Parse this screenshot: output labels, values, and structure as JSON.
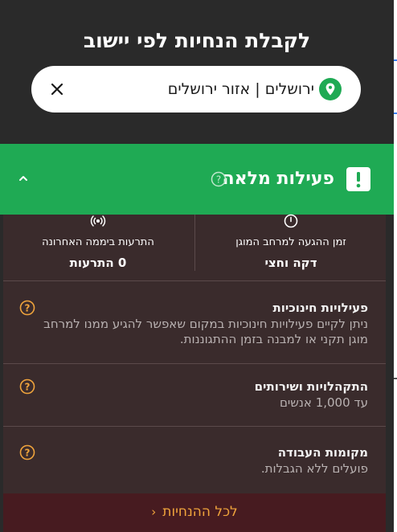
{
  "header": {
    "title": "לקבלת הנחיות לפי יישוב"
  },
  "search": {
    "value": "ירושלים | אזור ירושלים",
    "pin_icon": "location-pin-icon",
    "clear_icon": "close-icon"
  },
  "status": {
    "label": "פעילות מלאה",
    "color": "#1faa54",
    "alert_icon": "exclamation-icon",
    "help_icon": "question-circle-icon",
    "toggle_icon": "chevron-up-icon"
  },
  "stats": {
    "arrival": {
      "caption": "זמן ההגעה למרחב המוגן",
      "value": "דקה וחצי",
      "icon": "clock-icon"
    },
    "alerts": {
      "caption": "התרעות ביממה האחרונה",
      "value": "0 התרעות",
      "icon": "broadcast-icon"
    }
  },
  "items": [
    {
      "title": "פעילויות חינוכיות",
      "description": "ניתן לקיים פעילויות חינוכיות במקום שאפשר להגיע ממנו למרחב מוגן תקני או למבנה בזמן ההתגוננות."
    },
    {
      "title": "התקהלויות ושירותים",
      "description": "עד 1,000 אנשים"
    },
    {
      "title": "מקומות העבודה",
      "description": "פועלים ללא הגבלות."
    }
  ],
  "footer": {
    "link_label": "לכל ההנחיות",
    "accent": "#f0a43c"
  }
}
